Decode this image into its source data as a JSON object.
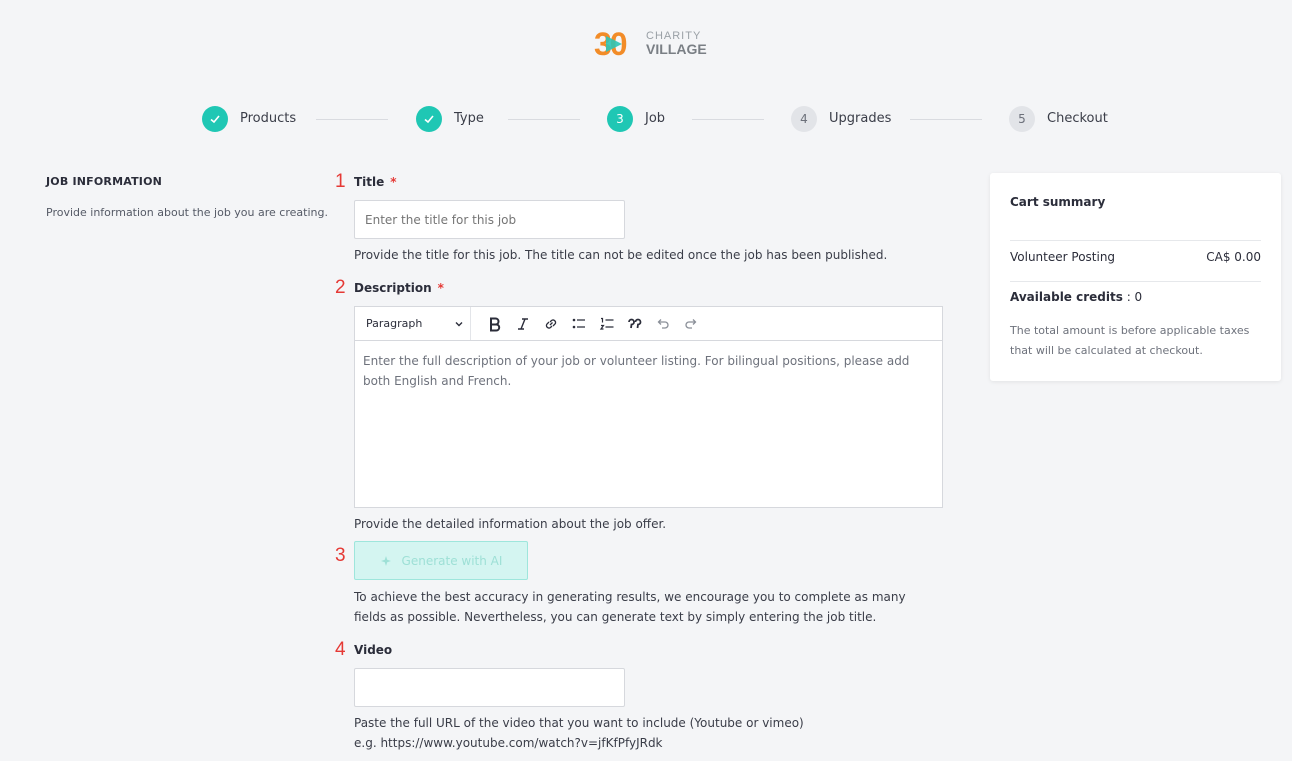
{
  "logo": {
    "number": "30",
    "line1": "CHARITY",
    "line2": "VILLAGE"
  },
  "colors": {
    "accent": "#1fc7b4",
    "required": "#e53935",
    "annotation": "#e53935"
  },
  "stepper": [
    {
      "label": "Products",
      "status": "done",
      "marker": "check-icon"
    },
    {
      "label": "Type",
      "status": "done",
      "marker": "check-icon"
    },
    {
      "label": "Job",
      "status": "active",
      "number": "3"
    },
    {
      "label": "Upgrades",
      "status": "todo",
      "number": "4"
    },
    {
      "label": "Checkout",
      "status": "todo",
      "number": "5"
    }
  ],
  "section": {
    "title": "JOB INFORMATION",
    "description": "Provide information about the job you are creating."
  },
  "form": {
    "title": {
      "annotation": "1",
      "label": "Title",
      "required": "*",
      "placeholder": "Enter the title for this job",
      "value": "",
      "help": "Provide the title for this job. The title can not be edited once the job has been published."
    },
    "description": {
      "annotation": "2",
      "label": "Description",
      "required": "*",
      "block_format": "Paragraph",
      "toolbar_icons": [
        "bold-icon",
        "italic-icon",
        "link-icon",
        "bulleted-list-icon",
        "numbered-list-icon",
        "quote-icon",
        "undo-icon",
        "redo-icon"
      ],
      "placeholder": "Enter the full description of your job or volunteer listing. For bilingual positions, please add both English and French.",
      "help": "Provide the detailed information about the job offer."
    },
    "ai": {
      "annotation": "3",
      "button_label": "Generate with AI",
      "icon": "sparkle-icon",
      "help": "To achieve the best accuracy in generating results, we encourage you to complete as many fields as possible. Nevertheless, you can generate text by simply entering the job title."
    },
    "video": {
      "annotation": "4",
      "label": "Video",
      "value": "",
      "help": "Paste the full URL of the video that you want to include (Youtube or vimeo) e.g. https://www.youtube.com/watch?v=jfKfPfyJRdk"
    }
  },
  "cart": {
    "title": "Cart summary",
    "item_name": "Volunteer Posting",
    "item_price": "CA$ 0.00",
    "credits_label": "Available credits",
    "credits_sep": " : ",
    "credits_value": "0",
    "note": "The total amount is before applicable taxes that will be calculated at checkout."
  }
}
